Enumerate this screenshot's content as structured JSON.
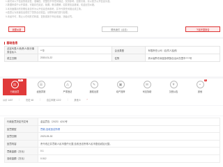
{
  "notice": {
    "lines": [
      "1.我们对以下信息的真实性、准确性、完整性不作任何保证，仅供参考。如需引用，请以官方公开信息为准。",
      "2.数据来源于公开渠道，可能存在延迟、缺漏，敬请理解；如发现信息错误，欢迎反馈纠错。",
      "3.本页面展示的关联信息仅作为公开信息查询参考，并不代表任何观点或立场。",
      "4.若您认为页面信息侵犯了您的合法权益，请联系我们进行处理。",
      "5.未经许可，禁止以任何形式转载、复制或用于商业用途，违者必究。"
    ],
    "btn_left": "我要纠错",
    "btn_mid": "联系我们（点击）",
    "btn_right": "下载完整报告"
  },
  "info": {
    "title": "基础信息",
    "rows": [
      {
        "l1": "法定代表人/负责人/执行事务合伙人",
        "v1": "**华",
        "l2": "企业类型",
        "v2": "有限责任公司（自然人独资）"
      },
      {
        "l1": "成立日期",
        "v1": "2015-01-22",
        "l2": "住所",
        "v2": "贵州省黔东南苗族侗族自治州凯里市****号"
      }
    ]
  },
  "tabs": [
    {
      "label": "行政处罚",
      "icon": "⚖",
      "extra": "15+",
      "active": true
    },
    {
      "label": "经营异常",
      "icon": "☰",
      "extra": "",
      "active": false
    },
    {
      "label": "严重违法",
      "icon": "⚠",
      "extra": "",
      "active": false
    },
    {
      "label": "股权出质",
      "icon": "✎",
      "extra": "",
      "active": false
    },
    {
      "label": "动产抵押",
      "icon": "▣",
      "extra": "",
      "active": false
    },
    {
      "label": "司法协助",
      "icon": "✉",
      "extra": "",
      "active": false
    },
    {
      "label": "欠税公告",
      "icon": "¥",
      "extra": "",
      "active": false
    },
    {
      "label": "其他",
      "icon": "•",
      "extra": "5",
      "active": false
    }
  ],
  "counts": {
    "a": "公示 1437",
    "b": "历史 48",
    "c": "自主申报 1222",
    "d": "其他 5"
  },
  "detail": {
    "rows": [
      {
        "label": "行政处罚决定书文号",
        "value": "金监罚告〔2023〕4210号",
        "link": false
      },
      {
        "label": "处罚类型",
        "value": "罚款;没收违法所得",
        "link": true
      },
      {
        "label": "处罚日期",
        "value": "2023-05-30",
        "link": false
      },
      {
        "label": "处罚内容",
        "value": "责令改正并罚款人民币壹仟元整,没收违法所得人民币壹佰贰拾元整。",
        "link": false
      },
      {
        "label": "罚款金额（万元）",
        "value": "0.1",
        "link": false
      },
      {
        "label": "没收金额（万元）",
        "value": "0.012",
        "link": false
      }
    ]
  }
}
